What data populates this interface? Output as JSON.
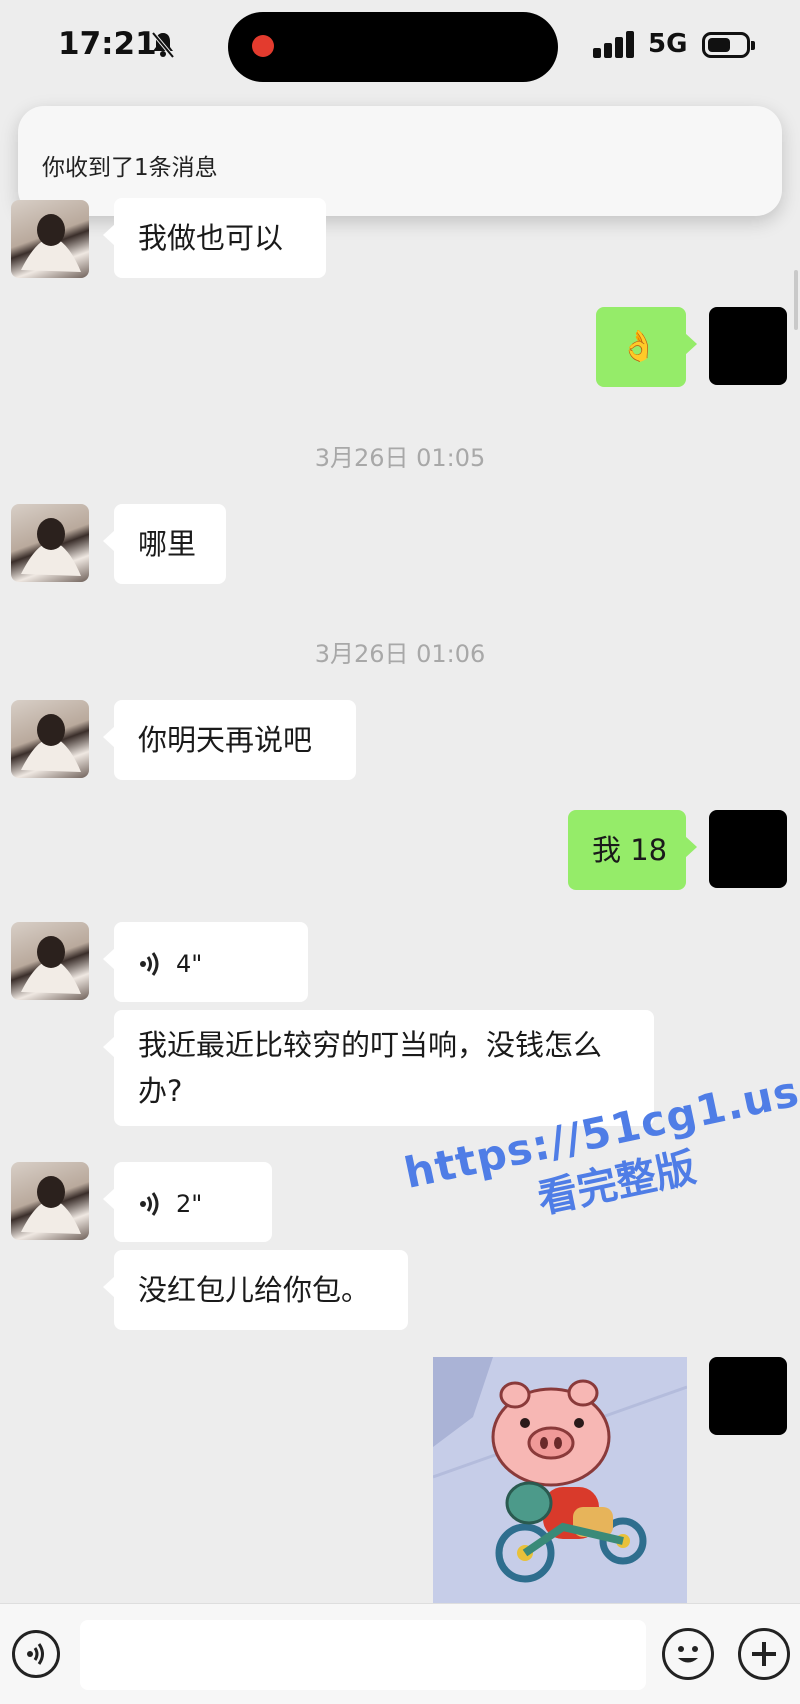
{
  "status_bar": {
    "time": "17:21",
    "network": "5G",
    "icons": [
      "bell-muted-icon",
      "signal-icon",
      "battery-icon"
    ]
  },
  "notification": {
    "text": "你收到了1条消息"
  },
  "messages": [
    {
      "side": "left",
      "text": "我做也可以"
    },
    {
      "side": "right",
      "text": "👌"
    },
    {
      "timestamp": "3月26日 01:05"
    },
    {
      "side": "left",
      "text": "哪里"
    },
    {
      "timestamp": "3月26日 01:06"
    },
    {
      "side": "left",
      "text": "你明天再说吧"
    },
    {
      "side": "right",
      "text": "我 18"
    },
    {
      "side": "left",
      "voice": "4\"",
      "text": "我近最近比较穷的叮当响，没钱怎么办?"
    },
    {
      "side": "left",
      "voice": "2\"",
      "text": "没红包儿给你包。"
    },
    {
      "side": "right",
      "sticker": "pig-on-tricycle"
    }
  ],
  "watermark": {
    "line1": "https://51cg1.us",
    "line2": "看完整版"
  },
  "input_bar": {
    "icons": [
      "voice-icon",
      "emoji-icon",
      "plus-icon"
    ]
  },
  "colors": {
    "background": "#ededed",
    "right_bubble": "#95ec69",
    "left_bubble": "#ffffff",
    "watermark": "#4f7de6"
  }
}
